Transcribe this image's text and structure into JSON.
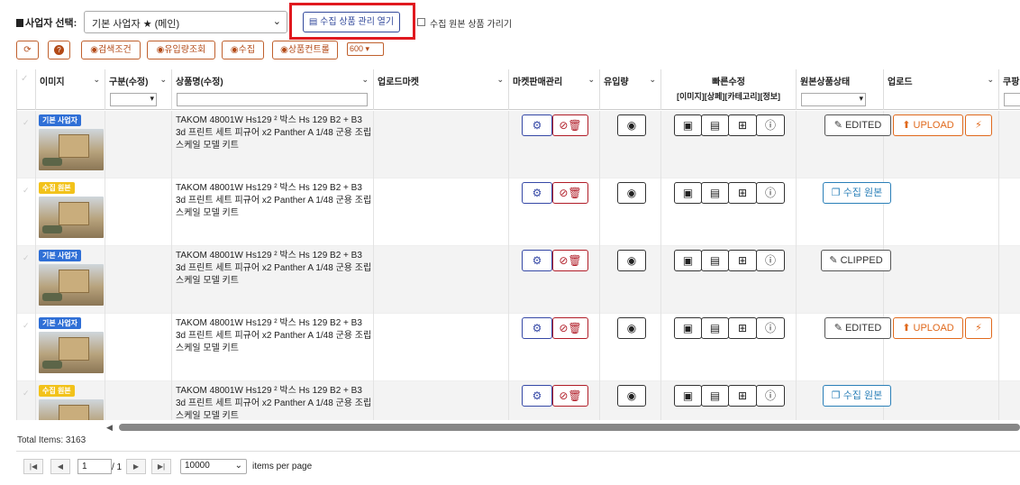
{
  "top": {
    "biz_label": "사업자 선택:",
    "biz_select_value": "기본 사업자 ★ (메인)",
    "open_button": "수집 상품 관리 열기",
    "hide_original_label": "수집 원본 상품 가리기"
  },
  "toolbar": {
    "refresh_icon": "refresh-icon",
    "help_icon": "question-icon",
    "search_conditions": "검색조건",
    "inflow_lookup": "유입량조회",
    "collect": "수집",
    "product_content": "상품컨트롤",
    "page_size": "600"
  },
  "columns": {
    "image": "이미지",
    "category": "구분(수정)",
    "product_name": "상품명(수정)",
    "upload_market": "업로드마켓",
    "market_mgmt": "마켓판매관리",
    "inflow": "유입량",
    "quick_edit": "빠른수정",
    "quick_edit_sub": "[이미지][상페][카테고리][정보]",
    "original_status": "원본상품상태",
    "upload": "업로드",
    "coupon": "쿠팡"
  },
  "rows": [
    {
      "badge": "기본 사업자",
      "badge_color": "blue",
      "name": "TAKOM 48001W Hs129 ² 박스 Hs 129 B2 + B3 3d 프린트 세트 피규어 x2 Panther A 1/48 군용 조립 스케일 모델 키트",
      "status": "EDITED",
      "status_type": "edited",
      "upload": "UPLOAD",
      "has_upload": true
    },
    {
      "badge": "수집 원본",
      "badge_color": "yellow",
      "name": "TAKOM 48001W Hs129 ² 박스 Hs 129 B2 + B3 3d 프린트 세트 피규어 x2 Panther A 1/48 군용 조립 스케일 모델 키트",
      "status": "수집 원본",
      "status_type": "origin",
      "upload": "",
      "has_upload": false
    },
    {
      "badge": "기본 사업자",
      "badge_color": "blue",
      "name": "TAKOM 48001W Hs129 ² 박스 Hs 129 B2 + B3 3d 프린트 세트 피규어 x2 Panther A 1/48 군용 조립 스케일 모델 키트",
      "status": "CLIPPED",
      "status_type": "clipped",
      "upload": "",
      "has_upload": false
    },
    {
      "badge": "기본 사업자",
      "badge_color": "blue",
      "name": "TAKOM 48001W Hs129 ² 박스 Hs 129 B2 + B3 3d 프린트 세트 피규어 x2 Panther A 1/48 군용 조립 스케일 모델 키트",
      "status": "EDITED",
      "status_type": "edited",
      "upload": "UPLOAD",
      "has_upload": true
    },
    {
      "badge": "수집 원본",
      "badge_color": "yellow",
      "name": "TAKOM 48001W Hs129 ² 박스 Hs 129 B2 + B3 3d 프린트 세트 피규어 x2 Panther A 1/48 군용 조립 스케일 모델 키트",
      "status": "수집 원본",
      "status_type": "origin",
      "upload": "",
      "has_upload": false
    }
  ],
  "footer": {
    "total_items": "Total Items: 3163",
    "page_value": "1",
    "page_total": "/ 1",
    "per_page_value": "10000",
    "per_page_label": "items per page"
  }
}
